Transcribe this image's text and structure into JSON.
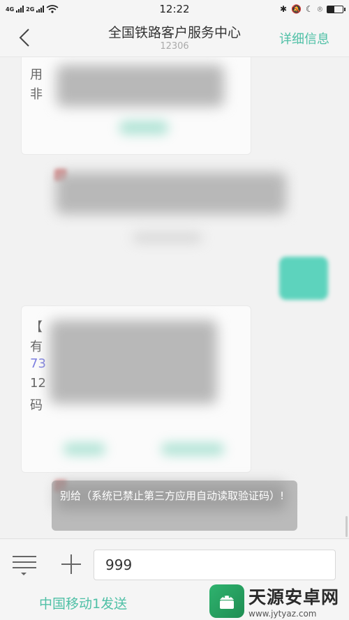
{
  "status_bar": {
    "signal_left": "4G",
    "signal_right": "2G",
    "time": "12:22"
  },
  "header": {
    "title": "全国铁路客户服务中心",
    "subtitle": "12306",
    "detail_label": "详细信息"
  },
  "chat": {
    "message1_lines": [
      "用",
      "非"
    ],
    "message2_lines": [
      "【",
      "有",
      "73",
      "12",
      "码"
    ]
  },
  "toast": {
    "text": "别给（系统已禁止第三方应用自动读取验证码）!"
  },
  "input_bar": {
    "input_value": "999",
    "send_label": "中国移动1发送"
  },
  "watermark": {
    "title": "天源安卓网",
    "url": "www.jytyaz.com"
  },
  "colors": {
    "accent": "#4fc0a6",
    "bubble_out": "#5dd3bd"
  }
}
